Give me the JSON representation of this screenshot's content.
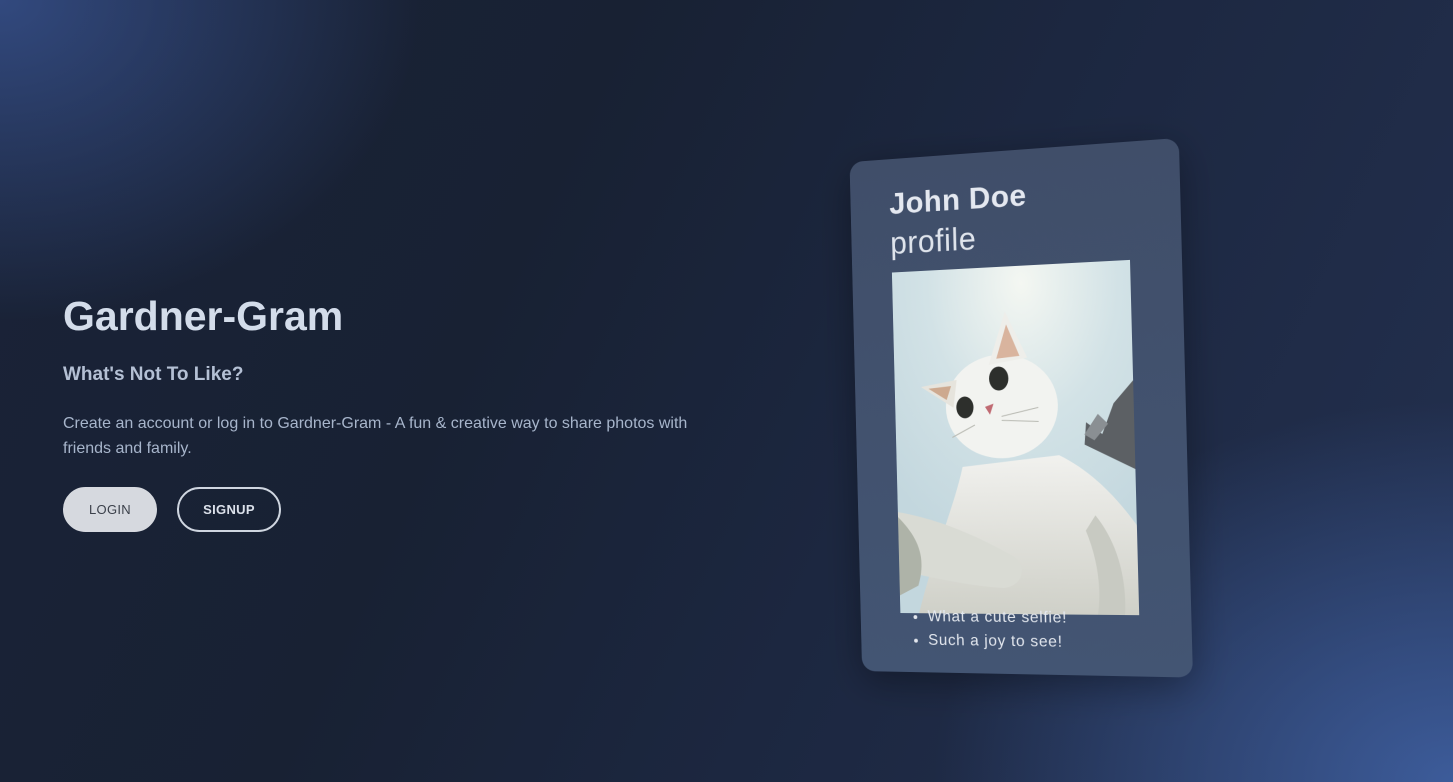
{
  "hero": {
    "title": "Gardner-Gram",
    "subtitle": "What's Not To Like?",
    "description": "Create an account or log in to Gardner-Gram - A fun & creative way to share photos with friends and family.",
    "login_label": "LOGIN",
    "signup_label": "SIGNUP"
  },
  "profile_card": {
    "name": "John Doe",
    "subtitle": "profile",
    "photo_subject": "white cat selfie",
    "comments": [
      "What a cute selfie!",
      "Such a joy to see!"
    ]
  },
  "colors": {
    "background": "#1a2338",
    "card": "#415170",
    "login_button": "#d6d9df",
    "title_text": "#d3dcea"
  }
}
